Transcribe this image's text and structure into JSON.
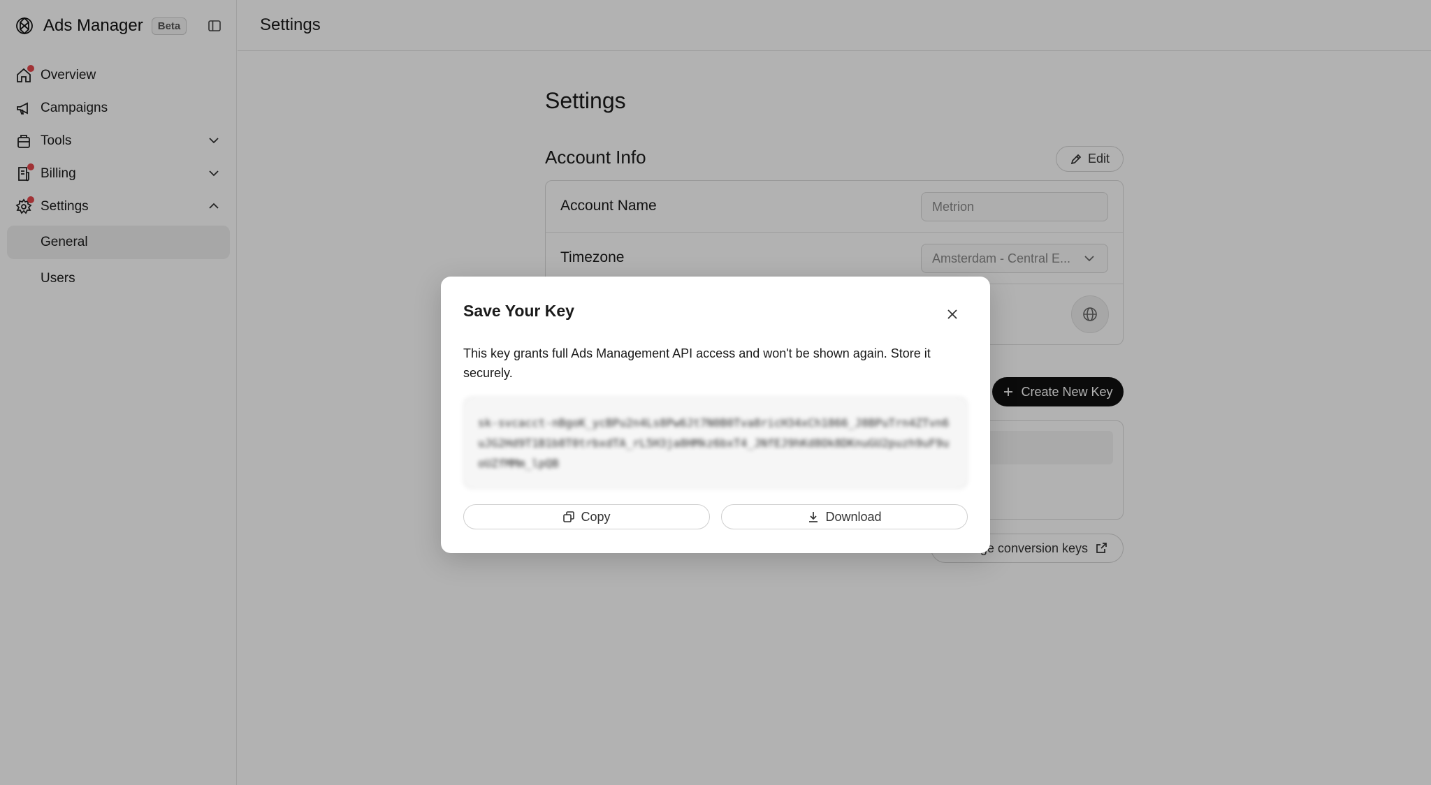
{
  "app": {
    "name": "Ads Manager",
    "badge": "Beta"
  },
  "sidebar": {
    "items": [
      {
        "label": "Overview",
        "icon": "home-icon",
        "notification": true
      },
      {
        "label": "Campaigns",
        "icon": "megaphone-icon",
        "notification": false
      },
      {
        "label": "Tools",
        "icon": "toolbox-icon",
        "notification": false,
        "expandable": true,
        "expanded": false
      },
      {
        "label": "Billing",
        "icon": "receipt-icon",
        "notification": true,
        "expandable": true,
        "expanded": false
      },
      {
        "label": "Settings",
        "icon": "gear-icon",
        "notification": true,
        "expandable": true,
        "expanded": true
      }
    ],
    "subitems": [
      {
        "label": "General",
        "active": true
      },
      {
        "label": "Users",
        "active": false
      }
    ]
  },
  "header": {
    "title": "Settings"
  },
  "main": {
    "title": "Settings",
    "account_info": {
      "title": "Account Info",
      "edit_label": "Edit",
      "account_name_label": "Account Name",
      "account_name_value": "Metrion",
      "timezone_label": "Timezone",
      "timezone_value": "Amsterdam - Central E..."
    },
    "create_key_label": "Create New Key",
    "conversion_keys_label": "ge conversion keys"
  },
  "modal": {
    "title": "Save Your Key",
    "description": "This key grants full Ads Management API access and won't be shown again. Store it securely.",
    "key_value": "sk-svcacct-nBgoK_ycBPu2n4Ls8Pw6Jt7N0B0Tva8ricH34xCh1866_J8BPuTrn4ZTvn6uJG2Hd9T1B1b8T0trbxdTA_rL5H3ja8HMkz6bxT4_JNfEJ9hKd8Ok8DKnuGU2puzh9uF9uoUZfMMm_lpQB",
    "copy_label": "Copy",
    "download_label": "Download"
  },
  "colors": {
    "notification_dot": "#e5484d",
    "primary_button": "#111111",
    "overlay": "rgba(0,0,0,0.30)"
  }
}
